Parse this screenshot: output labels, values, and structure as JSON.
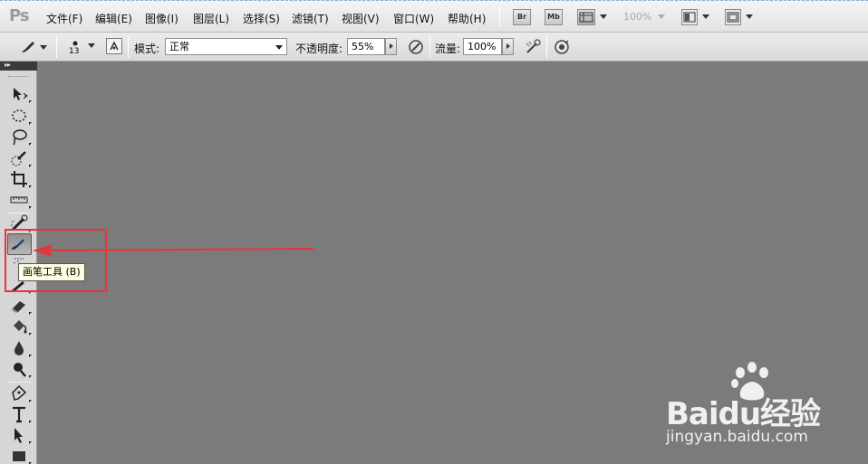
{
  "app": {
    "logo": "Ps"
  },
  "menu": {
    "items": [
      "文件(F)",
      "编辑(E)",
      "图像(I)",
      "图层(L)",
      "选择(S)",
      "滤镜(T)",
      "视图(V)",
      "窗口(W)",
      "帮助(H)"
    ],
    "br_label": "Br",
    "mb_label": "Mb",
    "zoom": "100%"
  },
  "options": {
    "brush_size": "13",
    "mode_label": "模式:",
    "mode_value": "正常",
    "opacity_label": "不透明度:",
    "opacity_value": "55%",
    "flow_label": "流量:",
    "flow_value": "100%"
  },
  "toolbox": {
    "tools": [
      {
        "name": "move-tool",
        "icon": "move-icon"
      },
      {
        "name": "marquee-tool",
        "icon": "ellipse-marquee-icon"
      },
      {
        "name": "lasso-tool",
        "icon": "lasso-icon"
      },
      {
        "name": "quick-select-tool",
        "icon": "quick-select-icon"
      },
      {
        "name": "crop-tool",
        "icon": "crop-icon"
      },
      {
        "name": "ruler-tool",
        "icon": "ruler-icon"
      },
      {
        "name": "healing-brush-tool",
        "icon": "healing-icon"
      },
      {
        "name": "brush-tool",
        "icon": "brush-icon"
      },
      {
        "name": "clone-stamp-tool",
        "icon": "stamp-icon"
      },
      {
        "name": "history-brush-tool",
        "icon": "history-brush-icon"
      },
      {
        "name": "eraser-tool",
        "icon": "eraser-icon"
      },
      {
        "name": "paint-bucket-tool",
        "icon": "bucket-icon"
      },
      {
        "name": "blur-tool",
        "icon": "drop-icon"
      },
      {
        "name": "dodge-tool",
        "icon": "dodge-icon"
      },
      {
        "name": "pen-tool",
        "icon": "pen-icon"
      },
      {
        "name": "type-tool",
        "icon": "type-icon"
      },
      {
        "name": "path-select-tool",
        "icon": "arrow-icon"
      },
      {
        "name": "shape-tool",
        "icon": "rectangle-icon"
      }
    ],
    "active_tool": "brush-tool"
  },
  "tooltip": {
    "text": "画笔工具 (B)"
  },
  "colors": {
    "canvas": "#7b7b7b",
    "highlight": "#e8343b"
  },
  "watermark": {
    "main": "Baidu经验",
    "sub": "jingyan.baidu.com"
  }
}
